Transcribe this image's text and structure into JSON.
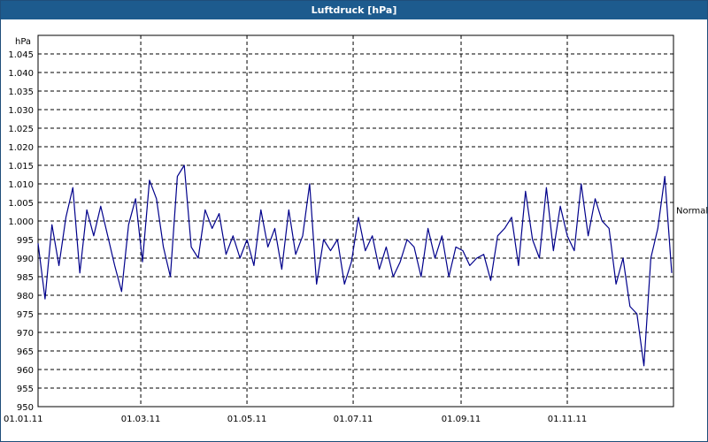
{
  "window": {
    "title": "Luftdruck [hPa]"
  },
  "chart_data": {
    "type": "line",
    "title": "Luftdruck [hPa]",
    "ylabel": "hPa",
    "xlabel": "",
    "ylim": [
      950,
      1050
    ],
    "y_ticks": [
      950,
      955,
      960,
      965,
      970,
      975,
      980,
      985,
      990,
      995,
      1000,
      1005,
      1010,
      1015,
      1020,
      1025,
      1030,
      1035,
      1040,
      1045
    ],
    "y_tick_labels": [
      "950",
      "955",
      "960",
      "965",
      "970",
      "975",
      "980",
      "985",
      "990",
      "995",
      "1.000",
      "1.005",
      "1.010",
      "1.015",
      "1.020",
      "1.025",
      "1.030",
      "1.035",
      "1.040",
      "1.045"
    ],
    "x_ticks": [
      "01.01.11",
      "01.03.11",
      "01.05.11",
      "01.07.11",
      "01.09.11",
      "01.11.11"
    ],
    "grid": true,
    "reference_line": {
      "label": "Normal",
      "value": 1003
    },
    "series": [
      {
        "color": "#00008b",
        "x": [
          "01.01.11",
          "05.01.11",
          "09.01.11",
          "13.01.11",
          "17.01.11",
          "21.01.11",
          "25.01.11",
          "29.01.11",
          "02.02.11",
          "06.02.11",
          "10.02.11",
          "14.02.11",
          "18.02.11",
          "22.02.11",
          "26.02.11",
          "02.03.11",
          "06.03.11",
          "10.03.11",
          "14.03.11",
          "18.03.11",
          "22.03.11",
          "26.03.11",
          "30.03.11",
          "03.04.11",
          "07.04.11",
          "11.04.11",
          "15.04.11",
          "19.04.11",
          "23.04.11",
          "27.04.11",
          "01.05.11",
          "05.05.11",
          "09.05.11",
          "13.05.11",
          "17.05.11",
          "21.05.11",
          "25.05.11",
          "29.05.11",
          "02.06.11",
          "06.06.11",
          "10.06.11",
          "14.06.11",
          "18.06.11",
          "22.06.11",
          "26.06.11",
          "30.06.11",
          "04.07.11",
          "08.07.11",
          "12.07.11",
          "16.07.11",
          "20.07.11",
          "24.07.11",
          "28.07.11",
          "01.08.11",
          "05.08.11",
          "09.08.11",
          "13.08.11",
          "17.08.11",
          "21.08.11",
          "25.08.11",
          "29.08.11",
          "02.09.11",
          "06.09.11",
          "10.09.11",
          "14.09.11",
          "18.09.11",
          "22.09.11",
          "26.09.11",
          "30.09.11",
          "04.10.11",
          "08.10.11",
          "12.10.11",
          "16.10.11",
          "20.10.11",
          "24.10.11",
          "28.10.11",
          "01.11.11",
          "05.11.11",
          "09.11.11",
          "13.11.11",
          "17.11.11",
          "21.11.11",
          "25.11.11",
          "29.11.11",
          "03.12.11",
          "07.12.11",
          "11.12.11",
          "15.12.11",
          "19.12.11",
          "23.12.11",
          "27.12.11",
          "31.12.11"
        ],
        "values": [
          994,
          979,
          999,
          988,
          1001,
          1009,
          986,
          1003,
          996,
          1004,
          996,
          988,
          981,
          999,
          1006,
          989,
          1011,
          1006,
          993,
          985,
          1012,
          1015,
          993,
          990,
          1003,
          998,
          1002,
          991,
          996,
          990,
          995,
          988,
          1003,
          993,
          998,
          987,
          1003,
          991,
          996,
          1010,
          983,
          995,
          992,
          995,
          983,
          989,
          1001,
          992,
          996,
          987,
          993,
          985,
          989,
          995,
          993,
          985,
          998,
          990,
          996,
          985,
          993,
          992,
          988,
          990,
          991,
          984,
          996,
          998,
          1001,
          988,
          1008,
          995,
          990,
          1009,
          992,
          1004,
          996,
          992,
          1010,
          996,
          1006,
          1000,
          998,
          983,
          990,
          977,
          975,
          961,
          990,
          998,
          1012,
          986
        ]
      }
    ]
  }
}
